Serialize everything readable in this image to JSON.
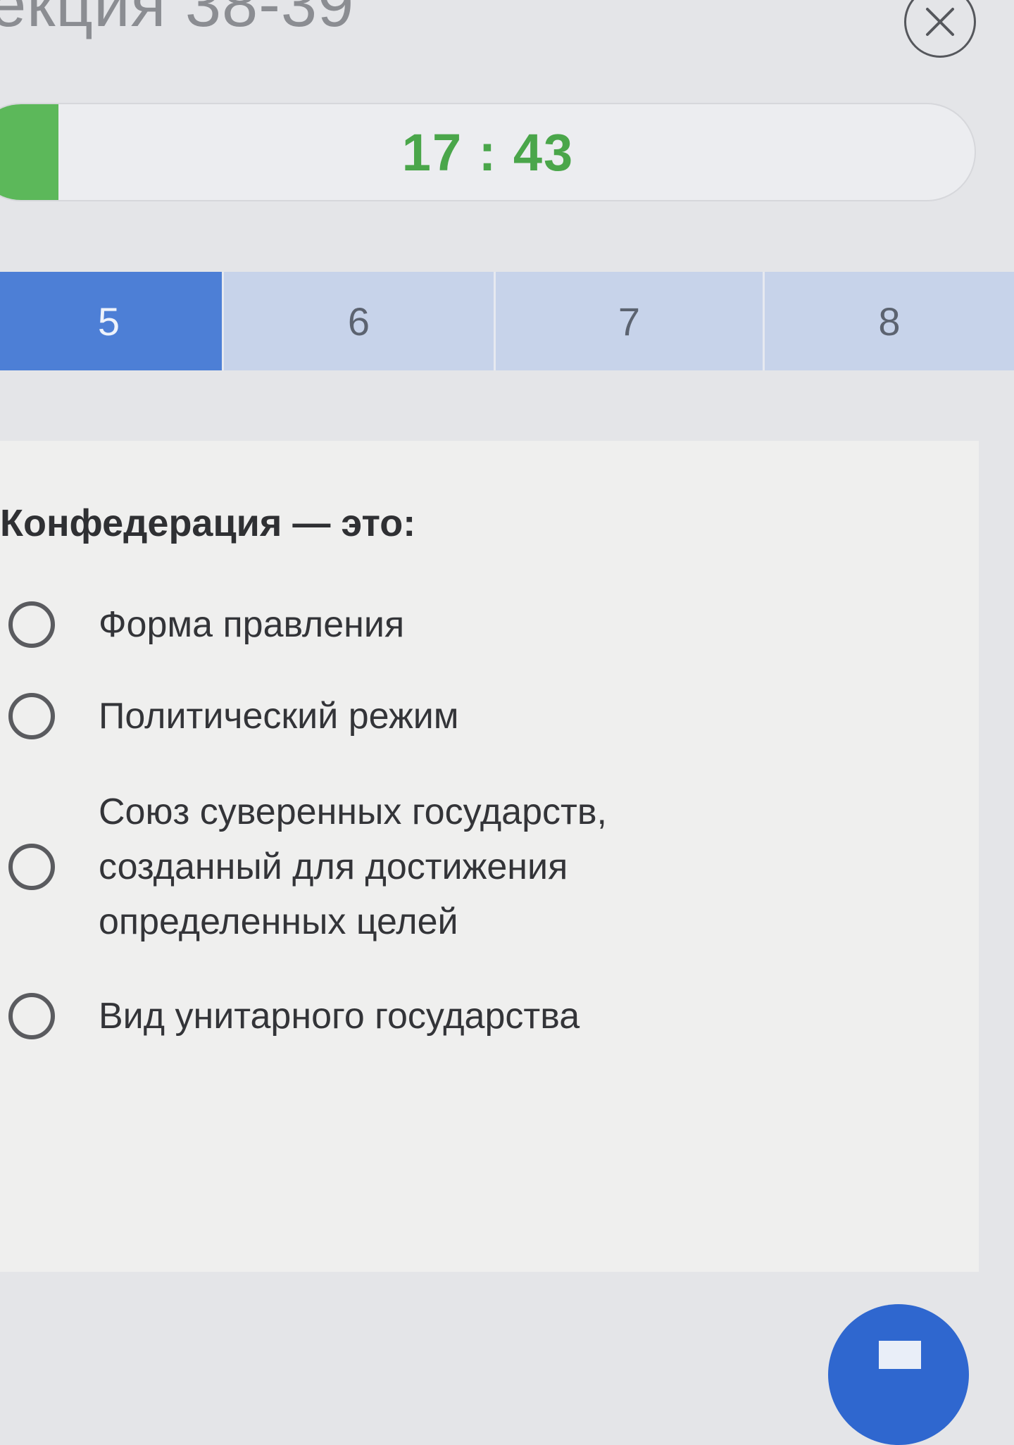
{
  "header": {
    "lecture_title": "екция 38-39",
    "close_icon": "close-icon"
  },
  "timer": {
    "time": "17 : 43",
    "remaining_fraction": 0.085,
    "color": "#5cb85a"
  },
  "tabs": [
    {
      "label": "5",
      "active": true
    },
    {
      "label": "6",
      "active": false
    },
    {
      "label": "7",
      "active": false
    },
    {
      "label": "8",
      "active": false
    }
  ],
  "question": {
    "text": "Конфедерация — это:",
    "options": [
      {
        "label": "Форма правления"
      },
      {
        "label": "Политический режим"
      },
      {
        "label": "Союз суверенных государств, созданный для достижения определенных целей"
      },
      {
        "label": "Вид унитарного государства"
      }
    ]
  },
  "colors": {
    "accent": "#4d7fd6",
    "tab_inactive": "#c7d3ea",
    "timer_text": "#4aa64a"
  }
}
